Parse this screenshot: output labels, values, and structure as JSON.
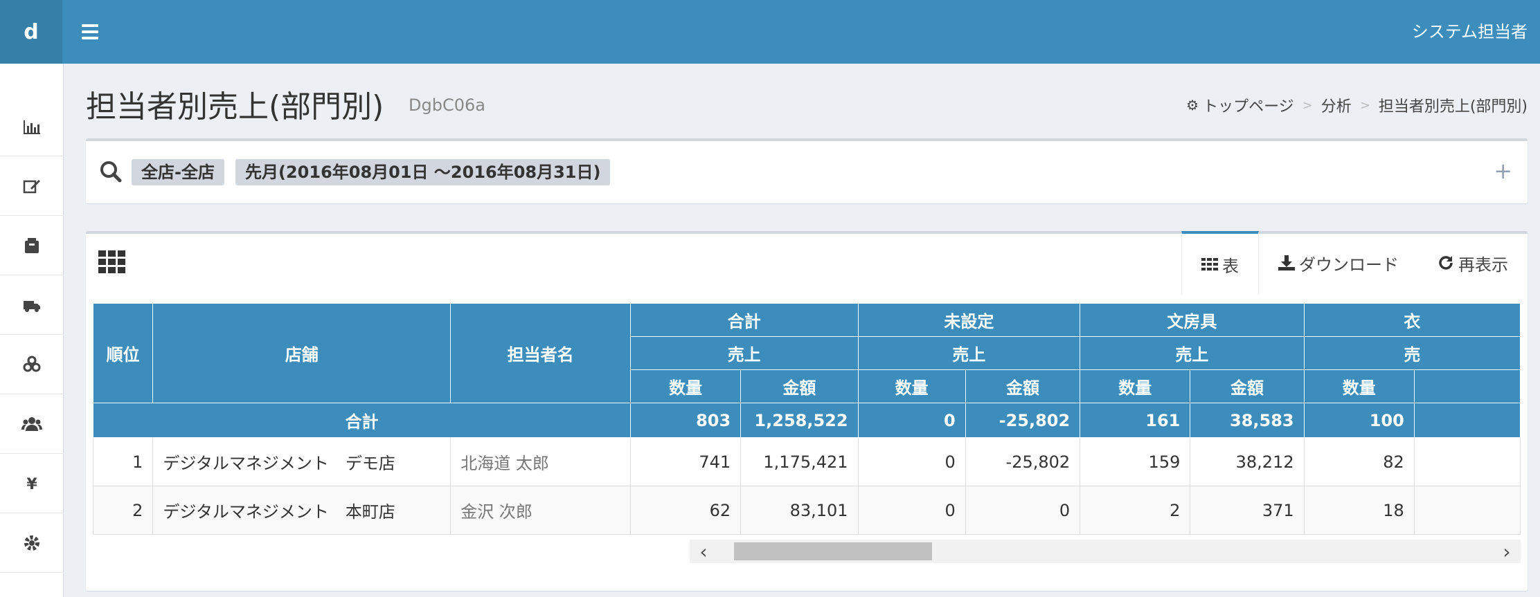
{
  "app": {
    "logo": "d",
    "user": "システム担当者"
  },
  "page": {
    "title": "担当者別売上(部門別)",
    "code": "DgbC06a"
  },
  "breadcrumb": {
    "items": [
      "トップページ",
      "分析",
      "担当者別売上(部門別)"
    ]
  },
  "filter": {
    "tags": [
      "全店-全店",
      "先月(2016年08月01日 〜2016年08月31日)"
    ],
    "expand": "+"
  },
  "tabs": {
    "table": "表",
    "download": "ダウンロード",
    "refresh": "再表示"
  },
  "table": {
    "headers": {
      "rank": "順位",
      "shop": "店舗",
      "staff": "担当者名"
    },
    "groups": [
      "合計",
      "未設定",
      "文房具",
      "衣"
    ],
    "sub": "売上",
    "sub_partial": "売",
    "qty": "数量",
    "amount": "金額",
    "total": {
      "label": "合計",
      "values": [
        "803",
        "1,258,522",
        "0",
        "-25,802",
        "161",
        "38,583",
        "100"
      ]
    },
    "rows": [
      {
        "rank": "1",
        "shop": "デジタルマネジメント　デモ店",
        "staff": "北海道 太郎",
        "values": [
          "741",
          "1,175,421",
          "0",
          "-25,802",
          "159",
          "38,212",
          "82"
        ]
      },
      {
        "rank": "2",
        "shop": "デジタルマネジメント　本町店",
        "staff": "金沢 次郎",
        "values": [
          "62",
          "83,101",
          "0",
          "0",
          "2",
          "371",
          "18"
        ]
      }
    ]
  },
  "sidebar": {
    "icons": [
      "bar-chart-icon",
      "edit-icon",
      "archive-icon",
      "truck-icon",
      "cubes-icon",
      "users-icon",
      "yen-icon",
      "gear-icon"
    ]
  }
}
